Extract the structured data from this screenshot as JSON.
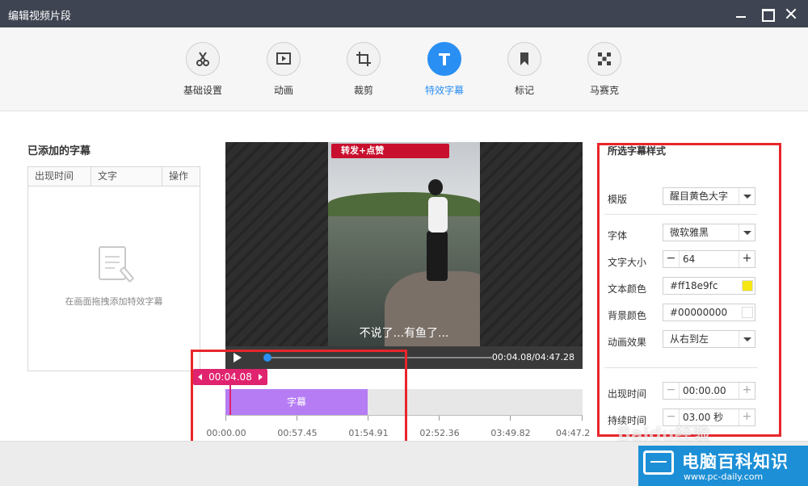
{
  "window": {
    "title": "编辑视频片段"
  },
  "toolbar": {
    "tools": [
      {
        "label": "基础设置",
        "icon": "scissors-icon"
      },
      {
        "label": "动画",
        "icon": "play-frame-icon"
      },
      {
        "label": "裁剪",
        "icon": "crop-icon"
      },
      {
        "label": "特效字幕",
        "icon": "text-t-icon",
        "active": true
      },
      {
        "label": "标记",
        "icon": "bookmark-icon"
      },
      {
        "label": "马赛克",
        "icon": "mosaic-icon"
      }
    ]
  },
  "left_panel": {
    "title": "已添加的字幕",
    "columns": [
      "出现时间",
      "文字",
      "操作"
    ],
    "empty_hint": "在画面拖拽添加特效字幕"
  },
  "video": {
    "banner_text": "转发+点赞",
    "caption": "不说了...有鱼了...",
    "time_readout": "00:04.08/04:47.28",
    "progress": 0.014
  },
  "timeline": {
    "current_tag": "00:04.08",
    "clip_label": "字幕",
    "ticks": [
      "00:00.00",
      "00:57.45",
      "01:54.91",
      "02:52.36",
      "03:49.82",
      "04:47.2"
    ]
  },
  "right_panel": {
    "title": "所选字幕样式",
    "template_label": "模版",
    "template_value": "醒目黄色大字",
    "font_label": "字体",
    "font_value": "微软雅黑",
    "size_label": "文字大小",
    "size_value": "64",
    "text_color_label": "文本颜色",
    "text_color_value": "#ff18e9fc",
    "text_color_swatch": "#f5e614",
    "bg_color_label": "背景颜色",
    "bg_color_value": "#00000000",
    "anim_label": "动画效果",
    "anim_value": "从右到左",
    "appear_label": "出现时间",
    "appear_value": "00:00.00",
    "duration_label": "持续时间",
    "duration_value": "03.00 秒"
  },
  "watermark": {
    "site_name": "电脑百科知识",
    "site_url": "www.pc-daily.com",
    "baidu": "Baidu经验"
  },
  "colors": {
    "accent": "#2a8ff2",
    "clip": "#b57cf3",
    "playhead": "#e0236e",
    "annotation": "#e8262b"
  }
}
